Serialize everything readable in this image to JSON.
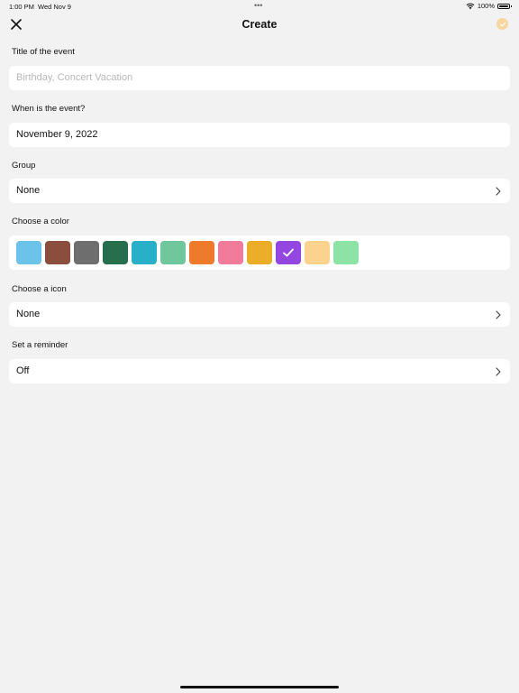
{
  "status_bar": {
    "time": "1:00 PM",
    "date": "Wed Nov 9",
    "dots": "•••",
    "battery_label": "100%",
    "battery_level": 1.0,
    "wifi_icon": "wifi-icon",
    "battery_icon": "battery-icon"
  },
  "nav": {
    "title": "Create",
    "close_icon": "close-icon",
    "confirm_icon": "checkmark-circle-icon",
    "confirm_color": "#f7d6a0"
  },
  "form": {
    "title_label": "Title of the event",
    "title_placeholder": "Birthday, Concert Vacation",
    "title_value": "",
    "date_label": "When is the event?",
    "date_value": "November 9, 2022",
    "group_label": "Group",
    "group_value": "None",
    "color_label": "Choose a color",
    "colors": [
      {
        "hex": "#6cc3ea",
        "selected": false
      },
      {
        "hex": "#8b4e3c",
        "selected": false
      },
      {
        "hex": "#6e6e6e",
        "selected": false
      },
      {
        "hex": "#276e4f",
        "selected": false
      },
      {
        "hex": "#27b0c8",
        "selected": false
      },
      {
        "hex": "#6fc79b",
        "selected": false
      },
      {
        "hex": "#ee7a2b",
        "selected": false
      },
      {
        "hex": "#f07b9a",
        "selected": false
      },
      {
        "hex": "#ecae28",
        "selected": false
      },
      {
        "hex": "#9446e0",
        "selected": true
      },
      {
        "hex": "#fbd38e",
        "selected": false
      },
      {
        "hex": "#8de3a5",
        "selected": false
      }
    ],
    "icon_label": "Choose a icon",
    "icon_value": "None",
    "reminder_label": "Set a reminder",
    "reminder_value": "Off"
  }
}
